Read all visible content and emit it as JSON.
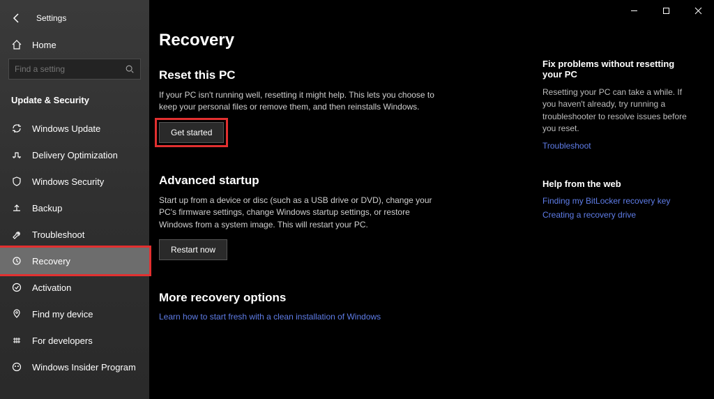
{
  "app": {
    "title": "Settings"
  },
  "home": {
    "label": "Home"
  },
  "search": {
    "placeholder": "Find a setting"
  },
  "section": {
    "title": "Update & Security"
  },
  "sidebar": {
    "items": [
      {
        "label": "Windows Update"
      },
      {
        "label": "Delivery Optimization"
      },
      {
        "label": "Windows Security"
      },
      {
        "label": "Backup"
      },
      {
        "label": "Troubleshoot"
      },
      {
        "label": "Recovery"
      },
      {
        "label": "Activation"
      },
      {
        "label": "Find my device"
      },
      {
        "label": "For developers"
      },
      {
        "label": "Windows Insider Program"
      }
    ]
  },
  "page": {
    "title": "Recovery",
    "reset": {
      "heading": "Reset this PC",
      "desc": "If your PC isn't running well, resetting it might help. This lets you choose to keep your personal files or remove them, and then reinstalls Windows.",
      "button": "Get started"
    },
    "advanced": {
      "heading": "Advanced startup",
      "desc": "Start up from a device or disc (such as a USB drive or DVD), change your PC's firmware settings, change Windows startup settings, or restore Windows from a system image. This will restart your PC.",
      "button": "Restart now"
    },
    "more": {
      "heading": "More recovery options",
      "link": "Learn how to start fresh with a clean installation of Windows"
    }
  },
  "aside": {
    "fix": {
      "heading": "Fix problems without resetting your PC",
      "desc": "Resetting your PC can take a while. If you haven't already, try running a troubleshooter to resolve issues before you reset.",
      "link": "Troubleshoot"
    },
    "help": {
      "heading": "Help from the web",
      "links": [
        "Finding my BitLocker recovery key",
        "Creating a recovery drive"
      ]
    }
  }
}
